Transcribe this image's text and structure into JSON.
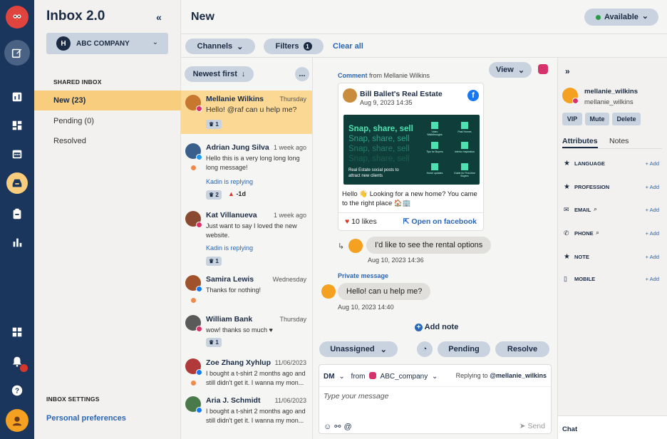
{
  "app": {
    "title": "Inbox 2.0",
    "collapse_icon": "double-chevron-left-icon"
  },
  "company": {
    "initial": "H",
    "name": "ABC COMPANY"
  },
  "nav": {
    "shared_heading": "SHARED INBOX",
    "items": [
      {
        "label": "New (23)",
        "active": true
      },
      {
        "label": "Pending (0)",
        "active": false
      },
      {
        "label": "Resolved",
        "active": false
      }
    ],
    "settings_heading": "INBOX SETTINGS",
    "preferences": "Personal preferences"
  },
  "rail_icons": [
    "owl-logo-icon",
    "compose-icon",
    "reports-icon",
    "dashboard-icon",
    "calendar-icon",
    "inbox-icon",
    "clipboard-icon",
    "analytics-icon",
    "apps-icon",
    "notifications-icon",
    "help-icon",
    "user-avatar-icon"
  ],
  "header": {
    "title": "New",
    "status": "Available"
  },
  "toolbar": {
    "channels": "Channels",
    "filters": "Filters",
    "filters_count": "1",
    "clear_all": "Clear all",
    "sort": "Newest first",
    "more": "..."
  },
  "conversations": [
    {
      "name": "Mellanie Wilkins",
      "time": "Thursday",
      "message": "Hello! @raf can u help me?",
      "chip": "1",
      "replying": "",
      "channel": "instagram",
      "avatar_color": "#c8782e"
    },
    {
      "name": "Adrian Jung Silva",
      "time": "1 week ago",
      "message": "Hello this is a very long long long long message!",
      "chip": "2",
      "alert": "-1d",
      "replying": "Kadin is replying",
      "channel": "twitter",
      "avatar_color": "#3a5f8a"
    },
    {
      "name": "Kat Villanueva",
      "time": "1 week ago",
      "message": "Just want to say I loved the new website.",
      "chip": "1",
      "replying": "Kadin is replying",
      "channel": "instagram",
      "avatar_color": "#8a4a32"
    },
    {
      "name": "Samira Lewis",
      "time": "Wednesday",
      "message": "Thanks for nothing!",
      "chip": "",
      "replying": "",
      "channel": "facebook",
      "avatar_color": "#a0522d"
    },
    {
      "name": "William Bank",
      "time": "Thursday",
      "message": "wow! thanks so much ♥",
      "chip": "1",
      "replying": "",
      "channel": "instagram",
      "avatar_color": "#5a5a5a"
    },
    {
      "name": "Zoe Zhang Xyhlup",
      "time": "11/06/2023",
      "message": "I bought a t-shirt 2 months ago and still didn't get it. I wanna my mon...",
      "chip": "",
      "replying": "",
      "channel": "facebook",
      "avatar_color": "#b03a3a"
    },
    {
      "name": "Aria J. Schmidt",
      "time": "11/06/2023",
      "message": "I bought a t-shirt 2 months ago and still didn't get it. I wanna my mon...",
      "chip": "",
      "replying": "",
      "channel": "facebook",
      "avatar_color": "#4a7a4a"
    }
  ],
  "chat": {
    "view": "View",
    "comment_label": "Comment",
    "comment_from": "from Mellanie Wilkins",
    "post": {
      "page": "Bill Ballet's Real Estate",
      "date": "Aug 9, 2023 14:35",
      "banner_line": "Snap, share, sell",
      "banner_caption": "Real Estate social posts to attract new clients",
      "tiles": [
        "Video Walkthroughs",
        "Past Homes",
        "Tips for Buyers",
        "Interior Inspiration",
        "Home updates",
        "Guide for First-time Buyers"
      ],
      "text": "Hello 👋 Looking for a new home? You came to the right place 🏠🏢",
      "likes": "10 likes",
      "open": "Open on facebook"
    },
    "reply": {
      "text": "I'd like to see the rental options",
      "time": "Aug 10, 2023 14:36"
    },
    "private_label": "Private message",
    "private": {
      "text": "Hello! can u help me?",
      "time": "Aug 10, 2023 14:40"
    },
    "add_note": "Add note",
    "assign": "Unassigned",
    "pending": "Pending",
    "resolve": "Resolve",
    "composer": {
      "type": "DM",
      "from": "from",
      "account": "ABC_company",
      "replying_to": "Replying to",
      "handle": "@mellanie_wilkins",
      "placeholder": "Type your message",
      "send": "Send"
    }
  },
  "contact": {
    "name": "mellanie_wilkins",
    "handle": "mellanie_wilkins",
    "actions": [
      "VIP",
      "Mute",
      "Delete"
    ],
    "tabs": [
      "Attributes",
      "Notes"
    ],
    "attributes": [
      {
        "label": "LANGUAGE",
        "icon": "star-icon"
      },
      {
        "label": "PROFESSION",
        "icon": "star-icon"
      },
      {
        "label": "EMAIL",
        "icon": "envelope-icon"
      },
      {
        "label": "PHONE",
        "icon": "phone-icon"
      },
      {
        "label": "NOTE",
        "icon": "star-icon"
      },
      {
        "label": "MOBILE",
        "icon": "mobile-icon"
      }
    ],
    "add_label": "+ Add",
    "chat_label": "Chat"
  },
  "colors": {
    "rail": "#1b365d",
    "selected": "#fbd893",
    "accent": "#2a66b3",
    "pill": "#c9d3df"
  }
}
